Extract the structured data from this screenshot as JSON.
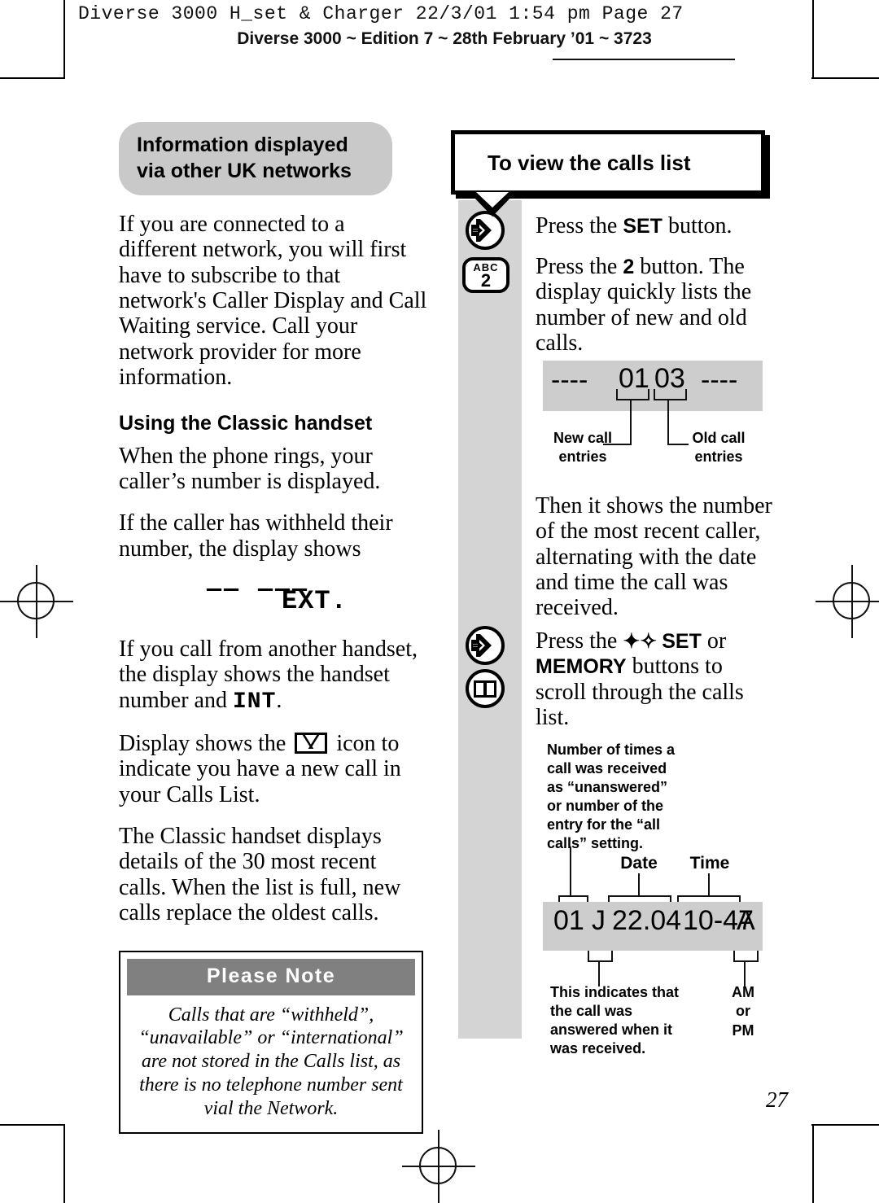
{
  "header": {
    "line1": "Diverse 3000 H_set & Charger  22/3/01  1:54 pm  Page 27",
    "line2": "Diverse 3000 ~ Edition 7 ~ 28th February ’01 ~ 3723"
  },
  "left_column": {
    "heading": "Information displayed via other UK networks",
    "paragraph1": "If you are connected to a different network, you will first have to subscribe to that network's Caller Display and Call Waiting service. Call your network provider for more information.",
    "subheading": "Using the Classic handset",
    "paragraph2": "When the phone rings, your caller’s number is displayed.",
    "paragraph3": "If the caller has withheld their number, the display shows",
    "withheld_display": {
      "dashes": "—— ———",
      "text": "EXT."
    },
    "paragraph4_a": "If you call from another handset, the display shows the handset number and ",
    "paragraph4_lcd": "INT",
    "paragraph4_b": ".",
    "paragraph5_a": "Display shows the ",
    "paragraph5_icon": "envelope-icon",
    "paragraph5_b": " icon to indicate you have a new call in your Calls List.",
    "paragraph6": "The Classic handset displays details of the 30 most recent calls. When the list is full, new calls replace the oldest calls.",
    "note": {
      "title": "Please Note",
      "body": "Calls that are “withheld”, “unavailable” or “international” are not stored in the Calls list, as there is no telephone number sent vial the Network."
    }
  },
  "right_column": {
    "bubble_title": "To view the calls list",
    "step1_a": "Press the ",
    "step1_bold": "SET",
    "step1_b": " button.",
    "step2_a": "Press the ",
    "step2_bold": "2",
    "step2_b": " button. The display quickly lists the number of new and old calls.",
    "step3": "Then it shows the number of the most recent caller, alternating with the date and time the call was received.",
    "step4_a": "Press the ",
    "step4_arrows": "✦✧",
    "step4_bold1": "SET",
    "step4_mid": " or ",
    "step4_bold2": "MEMORY",
    "step4_b": " buttons to scroll through the calls list.",
    "buttons": [
      {
        "name": "set-button",
        "icon": "set-arrow-icon"
      },
      {
        "name": "key-2-button",
        "letters": "ABC",
        "digit": "2"
      },
      {
        "name": "set-button",
        "icon": "set-arrow-icon"
      },
      {
        "name": "memory-button",
        "icon": "open-book-icon"
      }
    ],
    "lcd1": {
      "text": "---- 01 03 ----",
      "left_dashes": "----",
      "new_value": "01",
      "old_value": "03",
      "right_dashes": "----",
      "label_new": "New call entries",
      "label_old": "Old call entries"
    },
    "lcd2": {
      "text": "01 J 22.04 10-47 A",
      "count": "01",
      "day": "J",
      "date": "22.04",
      "time": "10-47",
      "ampm": "A",
      "label_date": "Date",
      "label_time": "Time",
      "label_count": "Number of times a call was received as “unanswered” or number of the entry for the “all calls” setting.",
      "label_answered": "This indicates that the call was answered when it was received.",
      "label_ampm": "AM or PM"
    }
  },
  "page_number": "27",
  "colors": {
    "grey_strip": "#d4d4d4",
    "lcd_grey": "#cdcdcd",
    "heading_grey": "#c9c9c9",
    "note_bar_grey": "#808080"
  }
}
